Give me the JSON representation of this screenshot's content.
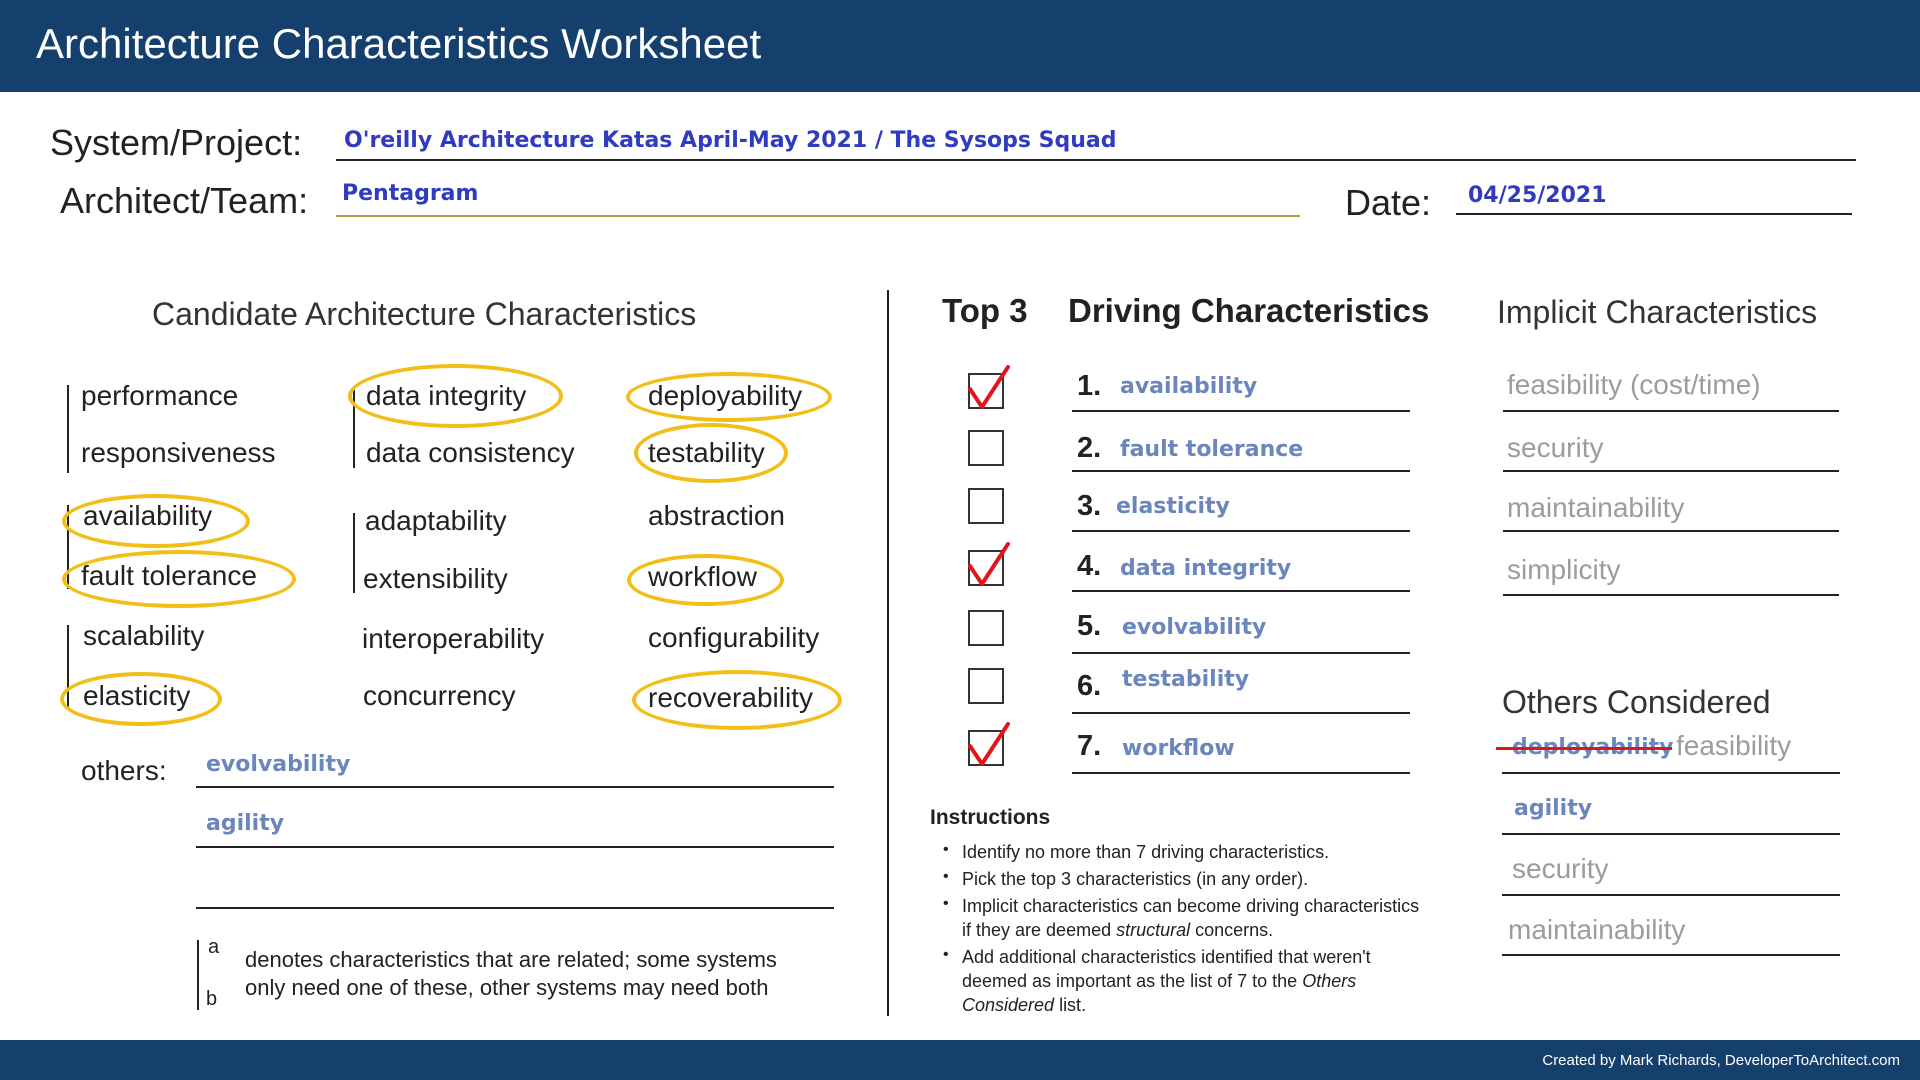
{
  "header": {
    "title": "Architecture Characteristics Worksheet"
  },
  "form": {
    "system_label": "System/Project:",
    "system_value": "O'reilly Architecture Katas April-May 2021 / The Sysops Squad",
    "architect_label": "Architect/Team:",
    "architect_value": "Pentagram",
    "date_label": "Date:",
    "date_value": "04/25/2021"
  },
  "candidates": {
    "title": "Candidate Architecture Characteristics",
    "col1": [
      "performance",
      "responsiveness",
      "availability",
      "fault tolerance",
      "scalability",
      "elasticity"
    ],
    "col2": [
      "data integrity",
      "data consistency",
      "adaptability",
      "extensibility",
      "interoperability",
      "concurrency"
    ],
    "col3": [
      "deployability",
      "testability",
      "abstraction",
      "workflow",
      "configurability",
      "recoverability"
    ],
    "circled": [
      "availability",
      "fault tolerance",
      "elasticity",
      "data integrity",
      "deployability",
      "testability",
      "workflow",
      "recoverability"
    ],
    "others_label": "others:",
    "others": [
      "evolvability",
      "agility",
      ""
    ]
  },
  "legend": {
    "a": "a",
    "b": "b",
    "line1": "denotes characteristics that are related; some systems",
    "line2": "only need one of these, other systems may need both"
  },
  "driving": {
    "top3_label": "Top 3",
    "title": "Driving Characteristics",
    "items": [
      {
        "num": "1.",
        "name": "availability",
        "checked": true
      },
      {
        "num": "2.",
        "name": "fault tolerance",
        "checked": false
      },
      {
        "num": "3.",
        "name": "elasticity",
        "checked": false
      },
      {
        "num": "4.",
        "name": "data integrity",
        "checked": true
      },
      {
        "num": "5.",
        "name": "evolvability",
        "checked": false
      },
      {
        "num": "6.",
        "name": "testability",
        "checked": false
      },
      {
        "num": "7.",
        "name": "workflow",
        "checked": true
      }
    ]
  },
  "implicit": {
    "title": "Implicit Characteristics",
    "items": [
      "feasibility (cost/time)",
      "security",
      "maintainability",
      "simplicity"
    ]
  },
  "others_considered": {
    "title": "Others Considered",
    "struck": "deployability",
    "first": "feasibility",
    "items": [
      "agility",
      "security",
      "maintainability"
    ]
  },
  "instructions": {
    "title": "Instructions",
    "bullet": "•",
    "items": [
      "Identify no more than 7 driving characteristics.",
      "Pick the top 3 characteristics (in any order).",
      "Implicit characteristics can become driving characteristics",
      "Add additional characteristics identified that weren't"
    ],
    "item3_cont_pre": "if they are deemed ",
    "item3_cont_em": "structural",
    "item3_cont_post": " concerns.",
    "item4_cont1_pre": "deemed as important as the list of 7 to the ",
    "item4_cont1_em": "Others",
    "item4_cont2_em": "Considered",
    "item4_cont2_post": " list."
  },
  "footer": {
    "credit": "Created by Mark Richards, DeveloperToArchitect.com"
  },
  "colors": {
    "header": "#15406e",
    "circle": "#f2bf19",
    "check": "#e0161a",
    "handwriting": "#2f3bc0",
    "handwriting_light": "#6a86bd"
  }
}
